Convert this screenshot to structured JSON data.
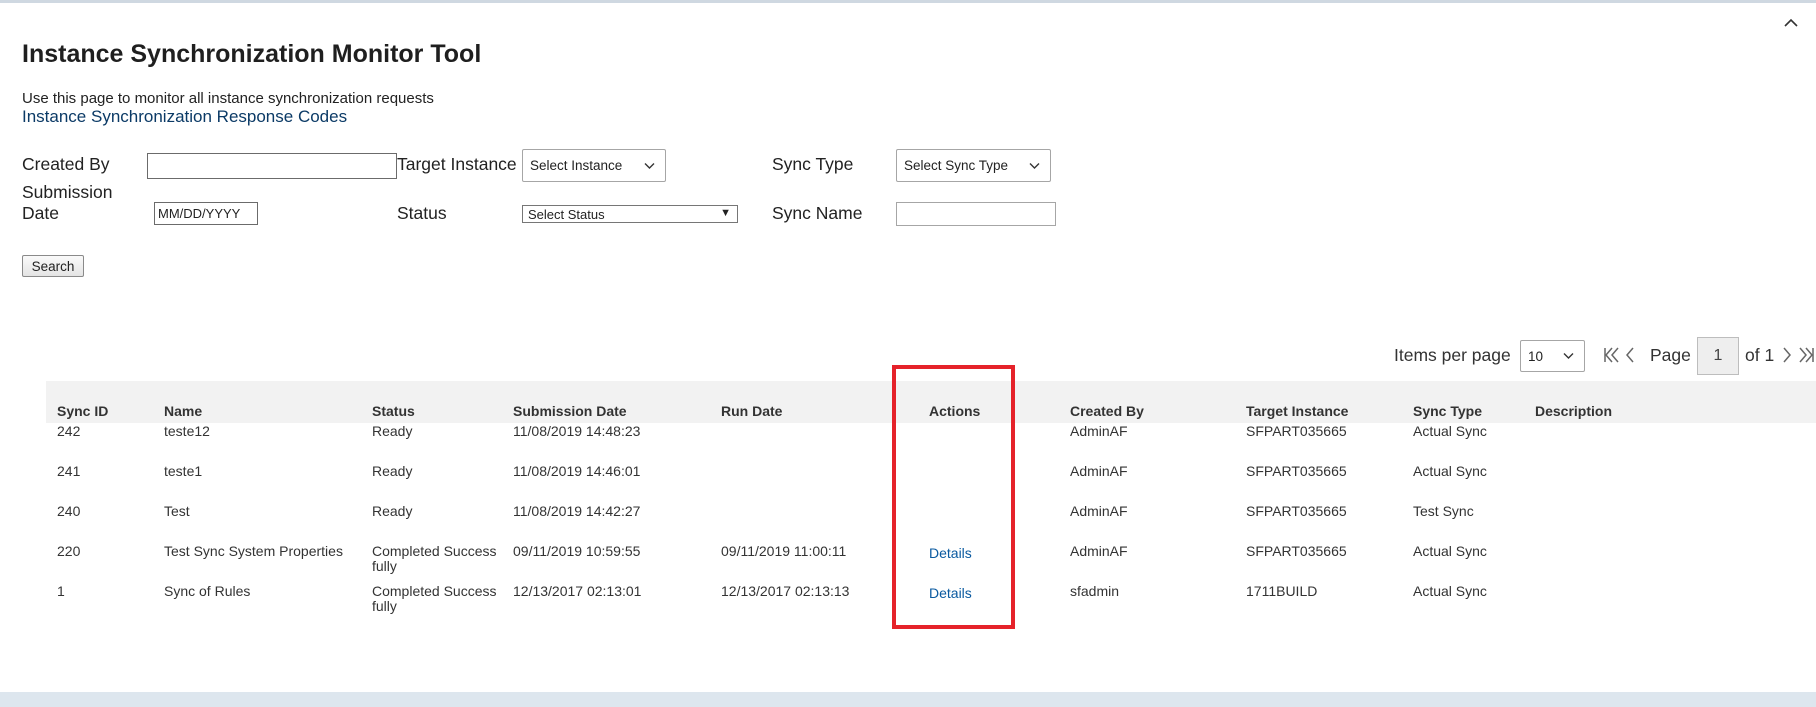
{
  "page": {
    "title": "Instance Synchronization Monitor Tool",
    "subtitle": "Use this page to monitor all instance synchronization requests",
    "codes_link": "Instance Synchronization Response Codes"
  },
  "filters": {
    "created_by_label": "Created By",
    "created_by_value": "",
    "target_instance_label": "Target Instance",
    "target_instance_value": "Select Instance",
    "sync_type_label": "Sync Type",
    "sync_type_value": "Select Sync Type",
    "submission_date_label_line1": "Submission",
    "submission_date_label_line2": "Date",
    "submission_date_value": "MM/DD/YYYY",
    "status_label": "Status",
    "status_value": "Select Status",
    "sync_name_label": "Sync Name",
    "sync_name_value": "",
    "search_label": "Search"
  },
  "pagination": {
    "items_per_page_label": "Items per page",
    "items_per_page_value": "10",
    "page_label": "Page",
    "page_value": "1",
    "of_label": "of 1"
  },
  "table": {
    "columns": [
      "Sync ID",
      "Name",
      "Status",
      "Submission Date",
      "Run Date",
      "Actions",
      "Created By",
      "Target Instance",
      "Sync Type",
      "Description"
    ],
    "rows": [
      {
        "id": "242",
        "name": "teste12",
        "status1": "Ready",
        "status2": "",
        "submitted": "11/08/2019 14:48:23",
        "run": "",
        "action": "",
        "created_by": "AdminAF",
        "target": "SFPART035665",
        "type": "Actual Sync",
        "description": ""
      },
      {
        "id": "241",
        "name": "teste1",
        "status1": "Ready",
        "status2": "",
        "submitted": "11/08/2019 14:46:01",
        "run": "",
        "action": "",
        "created_by": "AdminAF",
        "target": "SFPART035665",
        "type": "Actual Sync",
        "description": ""
      },
      {
        "id": "240",
        "name": "Test",
        "status1": "Ready",
        "status2": "",
        "submitted": "11/08/2019 14:42:27",
        "run": "",
        "action": "",
        "created_by": "AdminAF",
        "target": "SFPART035665",
        "type": "Test Sync",
        "description": ""
      },
      {
        "id": "220",
        "name": "Test Sync System Properties",
        "status1": "Completed Success",
        "status2": "fully",
        "submitted": "09/11/2019 10:59:55",
        "run": "09/11/2019 11:00:11",
        "action": "Details",
        "created_by": "AdminAF",
        "target": "SFPART035665",
        "type": "Actual Sync",
        "description": ""
      },
      {
        "id": "1",
        "name": "Sync of Rules",
        "status1": "Completed Success",
        "status2": "fully",
        "submitted": "12/13/2017 02:13:01",
        "run": "12/13/2017 02:13:13",
        "action": "Details",
        "created_by": "sfadmin",
        "target": "1711BUILD",
        "type": "Actual Sync",
        "description": ""
      }
    ]
  },
  "colors": {
    "link": "#0a5aa0",
    "highlight": "#e5222a",
    "header_bg": "#f2f2f2"
  },
  "icons": [
    "chevron-up-icon",
    "chevron-down-icon",
    "first-page-icon",
    "previous-page-icon",
    "next-page-icon",
    "last-page-icon"
  ]
}
